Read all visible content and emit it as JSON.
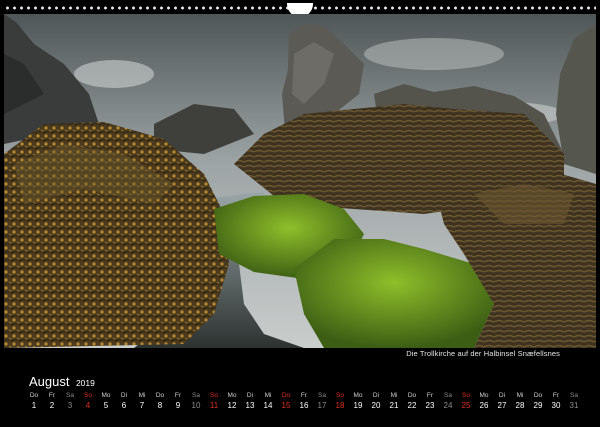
{
  "caption": "Die Trollkirche auf der Halbinsel Snæfellsnes",
  "calendar": {
    "month": "August",
    "year": "2019",
    "days": [
      {
        "wd": "Do",
        "d": "1",
        "kind": "wk"
      },
      {
        "wd": "Fr",
        "d": "2",
        "kind": "wk"
      },
      {
        "wd": "Sa",
        "d": "3",
        "kind": "sa"
      },
      {
        "wd": "So",
        "d": "4",
        "kind": "su"
      },
      {
        "wd": "Mo",
        "d": "5",
        "kind": "wk"
      },
      {
        "wd": "Di",
        "d": "6",
        "kind": "wk"
      },
      {
        "wd": "Mi",
        "d": "7",
        "kind": "wk"
      },
      {
        "wd": "Do",
        "d": "8",
        "kind": "wk"
      },
      {
        "wd": "Fr",
        "d": "9",
        "kind": "wk"
      },
      {
        "wd": "Sa",
        "d": "10",
        "kind": "sa"
      },
      {
        "wd": "So",
        "d": "11",
        "kind": "su"
      },
      {
        "wd": "Mo",
        "d": "12",
        "kind": "wk"
      },
      {
        "wd": "Di",
        "d": "13",
        "kind": "wk"
      },
      {
        "wd": "Mi",
        "d": "14",
        "kind": "wk"
      },
      {
        "wd": "Do",
        "d": "15",
        "kind": "hol"
      },
      {
        "wd": "Fr",
        "d": "16",
        "kind": "wk"
      },
      {
        "wd": "Sa",
        "d": "17",
        "kind": "sa"
      },
      {
        "wd": "So",
        "d": "18",
        "kind": "su"
      },
      {
        "wd": "Mo",
        "d": "19",
        "kind": "wk"
      },
      {
        "wd": "Di",
        "d": "20",
        "kind": "wk"
      },
      {
        "wd": "Mi",
        "d": "21",
        "kind": "wk"
      },
      {
        "wd": "Do",
        "d": "22",
        "kind": "wk"
      },
      {
        "wd": "Fr",
        "d": "23",
        "kind": "wk"
      },
      {
        "wd": "Sa",
        "d": "24",
        "kind": "sa"
      },
      {
        "wd": "So",
        "d": "25",
        "kind": "su"
      },
      {
        "wd": "Mo",
        "d": "26",
        "kind": "wk"
      },
      {
        "wd": "Di",
        "d": "27",
        "kind": "wk"
      },
      {
        "wd": "Mi",
        "d": "28",
        "kind": "wk"
      },
      {
        "wd": "Do",
        "d": "29",
        "kind": "wk"
      },
      {
        "wd": "Fr",
        "d": "30",
        "kind": "wk"
      },
      {
        "wd": "Sa",
        "d": "31",
        "kind": "sa"
      }
    ]
  },
  "colors": {
    "sunday_holiday": "#e0301e",
    "saturday": "#8c8c8c",
    "weekday": "#ffffff"
  }
}
